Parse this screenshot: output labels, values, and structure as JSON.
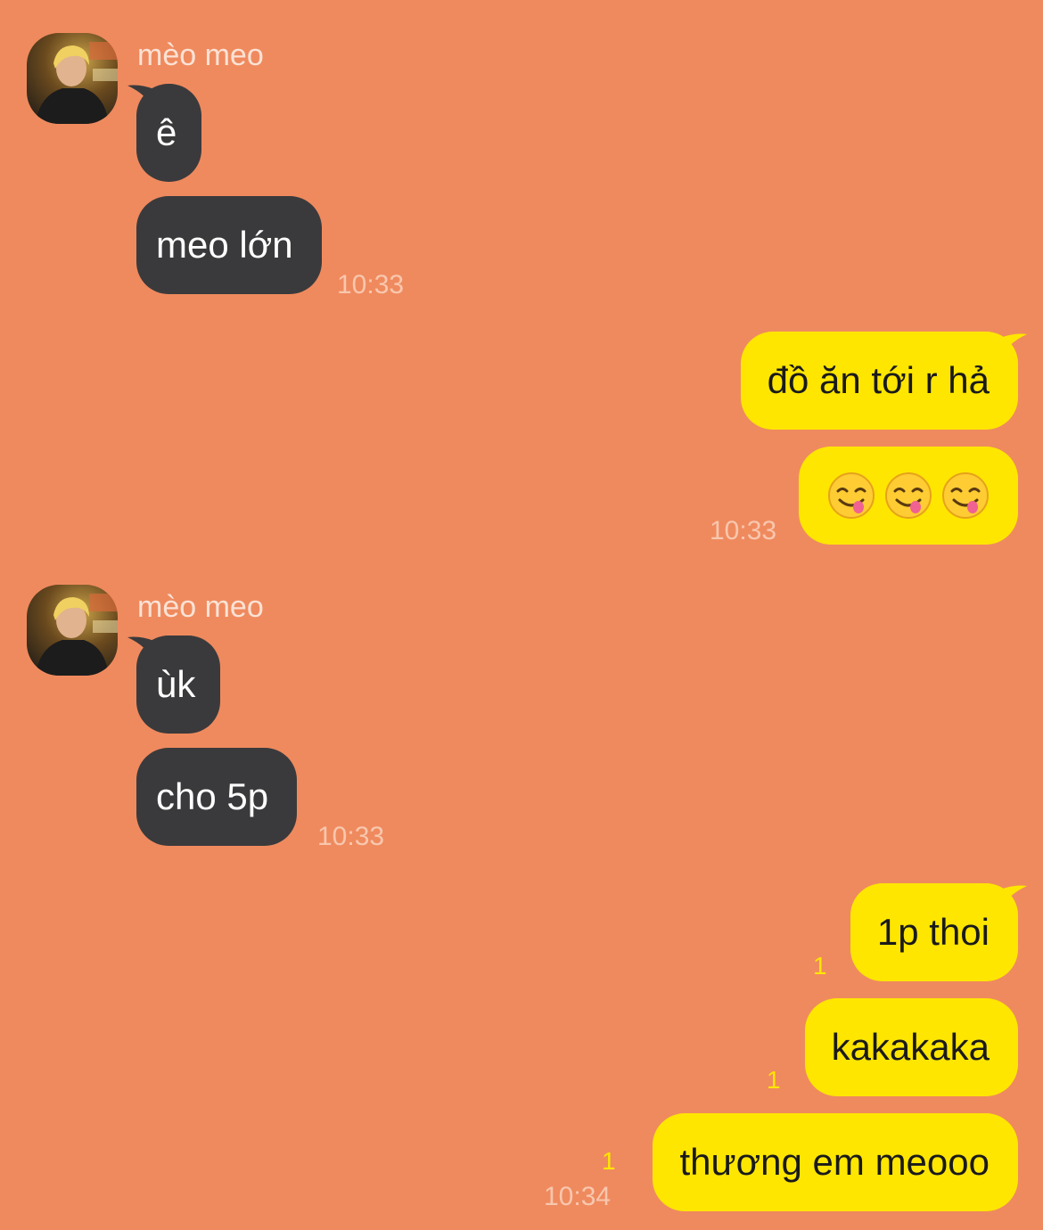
{
  "conversation": {
    "theme": {
      "background": "#EF8A5E",
      "incoming_bubble": "#3A3A3C",
      "outgoing_bubble": "#FFE600",
      "unread_color": "#FFE600"
    },
    "groups": [
      {
        "direction": "incoming",
        "sender_name": "mèo meo",
        "avatar_icon": "profile-photo",
        "messages": [
          {
            "text": "ê"
          },
          {
            "text": "meo lớn",
            "time": "10:33"
          }
        ]
      },
      {
        "direction": "outgoing",
        "messages": [
          {
            "text": "đồ ăn tới r hả"
          },
          {
            "emoji": "yum-face-emoji",
            "emoji_text": "😋😋😋",
            "time": "10:33"
          }
        ]
      },
      {
        "direction": "incoming",
        "sender_name": "mèo meo",
        "avatar_icon": "profile-photo",
        "messages": [
          {
            "text": "ùk"
          },
          {
            "text": "cho 5p",
            "time": "10:33"
          }
        ]
      },
      {
        "direction": "outgoing",
        "messages": [
          {
            "text": "1p thoi",
            "unread": "1"
          },
          {
            "text": "kakakaka",
            "unread": "1"
          },
          {
            "text": "thương em meooo",
            "unread": "1",
            "time": "10:34"
          }
        ]
      }
    ]
  }
}
